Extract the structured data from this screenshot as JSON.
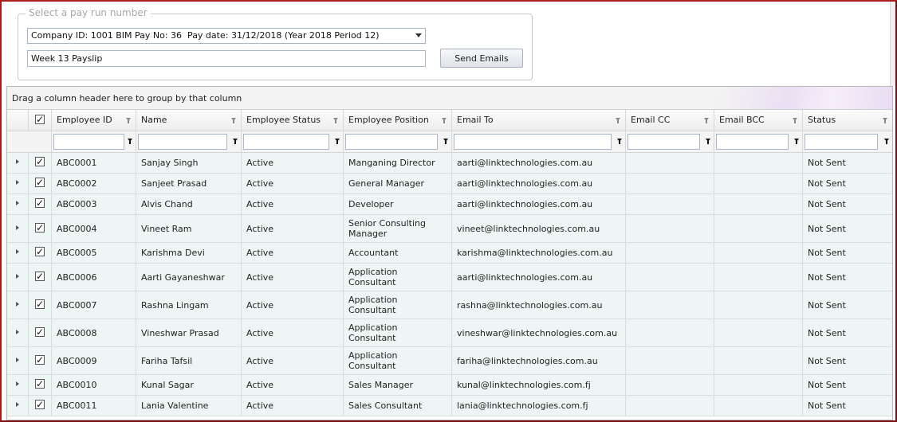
{
  "payrun": {
    "legend": "Select a pay run number",
    "selected_option": "Company ID: 1001 BIM Pay No: 36  Pay date: 31/12/2018 (Year 2018 Period 12)",
    "subject_value": "Week 13 Payslip",
    "send_button_label": "Send Emails"
  },
  "grid": {
    "group_panel_text": "Drag a column header here to group by that column",
    "columns": [
      "Employee ID",
      "Name",
      "Employee Status",
      "Employee Position",
      "Email To",
      "Email CC",
      "Email BCC",
      "Status"
    ],
    "check_mark": "✓",
    "rows": [
      {
        "id": "ABC0001",
        "name": "Sanjay Singh",
        "emp_status": "Active",
        "position": "Manganing Director",
        "email_to": "aarti@linktechnologies.com.au",
        "email_cc": "",
        "email_bcc": "",
        "status": "Not Sent",
        "checked": true
      },
      {
        "id": "ABC0002",
        "name": "Sanjeet Prasad",
        "emp_status": "Active",
        "position": "General Manager",
        "email_to": "aarti@linktechnologies.com.au",
        "email_cc": "",
        "email_bcc": "",
        "status": "Not Sent",
        "checked": true
      },
      {
        "id": "ABC0003",
        "name": "Alvis Chand",
        "emp_status": "Active",
        "position": "Developer",
        "email_to": "aarti@linktechnologies.com.au",
        "email_cc": "",
        "email_bcc": "",
        "status": "Not Sent",
        "checked": true
      },
      {
        "id": "ABC0004",
        "name": "Vineet Ram",
        "emp_status": "Active",
        "position": "Senior Consulting\nManager",
        "email_to": "vineet@linktechnologies.com.au",
        "email_cc": "",
        "email_bcc": "",
        "status": "Not Sent",
        "checked": true
      },
      {
        "id": "ABC0005",
        "name": "Karishma Devi",
        "emp_status": "Active",
        "position": "Accountant",
        "email_to": "karishma@linktechnologies.com.au",
        "email_cc": "",
        "email_bcc": "",
        "status": "Not Sent",
        "checked": true
      },
      {
        "id": "ABC0006",
        "name": "Aarti Gayaneshwar",
        "emp_status": "Active",
        "position": "Application\nConsultant",
        "email_to": "aarti@linktechnologies.com.au",
        "email_cc": "",
        "email_bcc": "",
        "status": "Not Sent",
        "checked": true
      },
      {
        "id": "ABC0007",
        "name": "Rashna Lingam",
        "emp_status": "Active",
        "position": "Application\nConsultant",
        "email_to": "rashna@linktechnologies.com.au",
        "email_cc": "",
        "email_bcc": "",
        "status": "Not Sent",
        "checked": true
      },
      {
        "id": "ABC0008",
        "name": "Vineshwar Prasad",
        "emp_status": "Active",
        "position": "Application\nConsultant",
        "email_to": "vineshwar@linktechnologies.com.au",
        "email_cc": "",
        "email_bcc": "",
        "status": "Not Sent",
        "checked": true
      },
      {
        "id": "ABC0009",
        "name": "Fariha Tafsil",
        "emp_status": "Active",
        "position": "Application\nConsultant",
        "email_to": "fariha@linktechnologies.com.au",
        "email_cc": "",
        "email_bcc": "",
        "status": "Not Sent",
        "checked": true
      },
      {
        "id": "ABC0010",
        "name": "Kunal Sagar",
        "emp_status": "Active",
        "position": "Sales Manager",
        "email_to": "kunal@linktechnologies.com.fj",
        "email_cc": "",
        "email_bcc": "",
        "status": "Not Sent",
        "checked": true
      },
      {
        "id": "ABC0011",
        "name": "Lania Valentine",
        "emp_status": "Active",
        "position": "Sales Consultant",
        "email_to": "lania@linktechnologies.com.fj",
        "email_cc": "",
        "email_bcc": "",
        "status": "Not Sent",
        "checked": true
      }
    ]
  },
  "colors": {
    "window_border": "#a81c1c",
    "row_background": "#eef6f5",
    "group_panel_accent": "#eadff3"
  }
}
